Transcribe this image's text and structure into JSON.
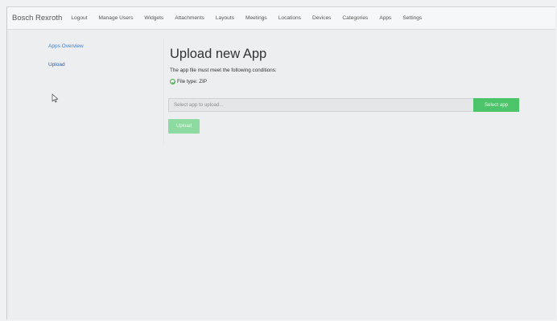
{
  "navbar": {
    "brand": "Bosch Rexroth",
    "items": [
      "Logout",
      "Manage Users",
      "Widgets",
      "Attachments",
      "Layouts",
      "Meetings",
      "Locations",
      "Devices",
      "Categories",
      "Apps",
      "Settings"
    ]
  },
  "sidebar": {
    "items": [
      {
        "label": "Apps Overview"
      },
      {
        "label": "Upload"
      }
    ]
  },
  "main": {
    "title": "Upload new App",
    "conditions_text": "The app file must meet the following conditions:",
    "file_type_label": "File type: ZIP",
    "file_input_placeholder": "Select app to upload...",
    "select_button_label": "Select app",
    "upload_button_label": "Upload"
  },
  "colors": {
    "accent_green": "#4cc56a",
    "link_blue": "#3b7fd0"
  }
}
